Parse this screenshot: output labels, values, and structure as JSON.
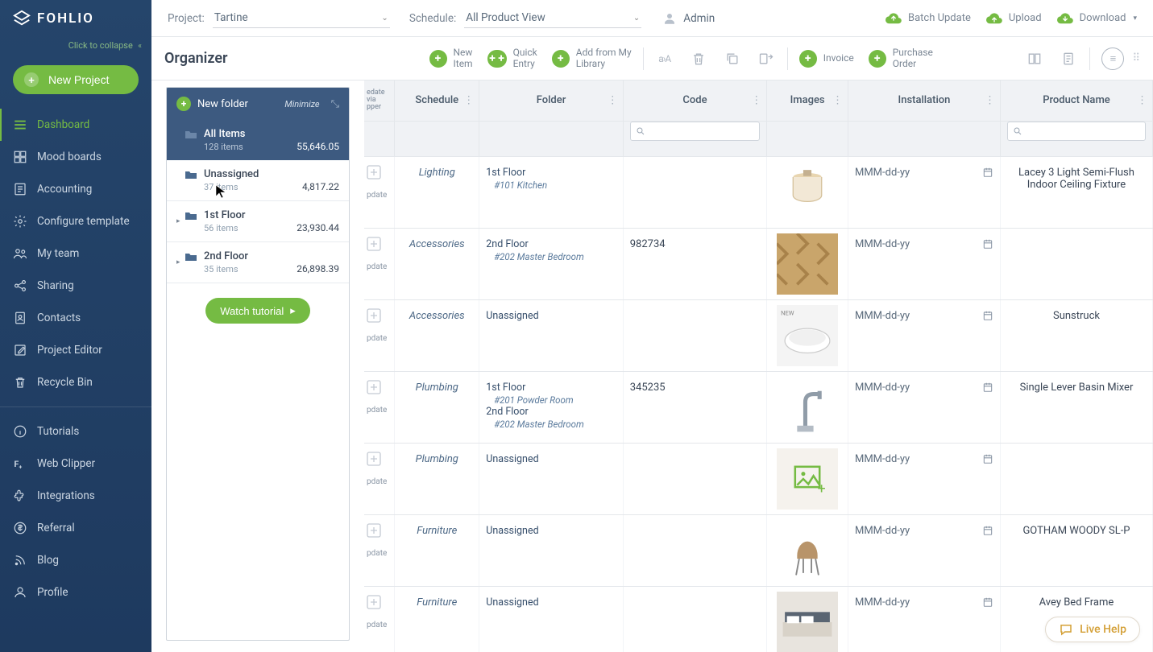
{
  "brand": "FOHLIO",
  "collapse": "Click to collapse",
  "new_project": "New Project",
  "nav": {
    "top": [
      {
        "label": "Dashboard",
        "active": true,
        "icon": "dashboard"
      },
      {
        "label": "Mood boards",
        "icon": "mood"
      },
      {
        "label": "Accounting",
        "icon": "accounting"
      },
      {
        "label": "Configure template",
        "icon": "gear"
      },
      {
        "label": "My team",
        "icon": "team"
      },
      {
        "label": "Sharing",
        "icon": "share"
      },
      {
        "label": "Contacts",
        "icon": "contacts"
      },
      {
        "label": "Project Editor",
        "icon": "edit"
      },
      {
        "label": "Recycle Bin",
        "icon": "trash"
      }
    ],
    "bottom": [
      {
        "label": "Tutorials",
        "icon": "info"
      },
      {
        "label": "Web Clipper",
        "icon": "clipper"
      },
      {
        "label": "Integrations",
        "icon": "puzzle"
      },
      {
        "label": "Referral",
        "icon": "dollar"
      },
      {
        "label": "Blog",
        "icon": "rss"
      },
      {
        "label": "Profile",
        "icon": "user"
      }
    ]
  },
  "topbar": {
    "project_label": "Project:",
    "project_value": "Tartine",
    "schedule_label": "Schedule:",
    "schedule_value": "All Product View",
    "admin": "Admin",
    "batch": "Batch Update",
    "upload": "Upload",
    "download": "Download"
  },
  "toolbar": {
    "title": "Organizer",
    "new_item": "New\nItem",
    "quick_entry": "Quick\nEntry",
    "add_lib": "Add from My\nLibrary",
    "invoice": "Invoice",
    "po": "Purchase\nOrder"
  },
  "organizer": {
    "new_folder": "New folder",
    "minimize": "Minimize",
    "rows": [
      {
        "name": "All Items",
        "meta": "128 items",
        "amount": "55,646.05",
        "type": "all"
      },
      {
        "name": "Unassigned",
        "meta": "37 items",
        "amount": "4,817.22",
        "type": "sel"
      },
      {
        "name": "1st Floor",
        "meta": "56 items",
        "amount": "23,930.44",
        "type": "exp"
      },
      {
        "name": "2nd Floor",
        "meta": "35 items",
        "amount": "26,898.39",
        "type": "exp"
      }
    ],
    "watch": "Watch tutorial"
  },
  "table": {
    "header": {
      "c0": "edate\nvia\npper",
      "c1": "Schedule",
      "c2": "Folder",
      "c3": "Code",
      "c4": "Images",
      "c5": "Installation",
      "c6": "Product Name"
    },
    "pdate": "pdate",
    "rows": [
      {
        "schedule": "Lighting",
        "folder": [
          {
            "main": "1st Floor",
            "sub": "#101 Kitchen"
          }
        ],
        "code": "",
        "img": "light",
        "install": "MMM-dd-yy",
        "product": "Lacey 3 Light Semi-Flush Indoor Ceiling Fixture"
      },
      {
        "schedule": "Accessories",
        "folder": [
          {
            "main": "2nd Floor",
            "sub": "#202 Master Bedroom"
          }
        ],
        "code": "982734",
        "img": "pattern",
        "install": "MMM-dd-yy",
        "product": ""
      },
      {
        "schedule": "Accessories",
        "folder": [
          {
            "main": "Unassigned"
          }
        ],
        "code": "",
        "img": "tub",
        "install": "MMM-dd-yy",
        "product": "Sunstruck"
      },
      {
        "schedule": "Plumbing",
        "folder": [
          {
            "main": "1st Floor",
            "sub": "#201 Powder Room"
          },
          {
            "main": "2nd Floor",
            "sub": "#202 Master Bedroom"
          }
        ],
        "code": "345235",
        "img": "faucet",
        "install": "MMM-dd-yy",
        "product": "Single Lever Basin Mixer"
      },
      {
        "schedule": "Plumbing",
        "folder": [
          {
            "main": "Unassigned"
          }
        ],
        "code": "",
        "img": "placeholder",
        "install": "MMM-dd-yy",
        "product": ""
      },
      {
        "schedule": "Furniture",
        "folder": [
          {
            "main": "Unassigned"
          }
        ],
        "code": "",
        "img": "chair",
        "install": "MMM-dd-yy",
        "product": "GOTHAM WOODY SL-P"
      },
      {
        "schedule": "Furniture",
        "folder": [
          {
            "main": "Unassigned"
          }
        ],
        "code": "",
        "img": "bed",
        "install": "MMM-dd-yy",
        "product": "Avey Bed Frame"
      }
    ]
  },
  "live_help": "Live Help"
}
